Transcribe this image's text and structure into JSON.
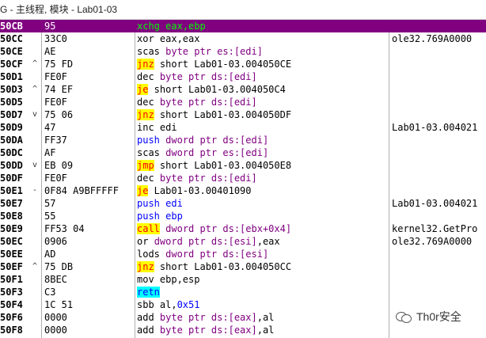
{
  "window": {
    "title": "G - 主线程, 模块 - Lab01-03"
  },
  "colors": {
    "selected_row": "#800080",
    "jcc_bg": "#ffff00",
    "jcc_fg": "#ff0000",
    "push_fg": "#0000ff",
    "mem_fg": "#800080",
    "ret_bg": "#00ffff"
  },
  "rows": [
    {
      "addr": "50CB",
      "jmp": "",
      "hex": "95",
      "tokens": [
        {
          "t": "xchg eax,",
          "s": "selx"
        },
        {
          "t": "ebp",
          "s": "selx"
        }
      ],
      "comment": "",
      "selected": true
    },
    {
      "addr": "50CC",
      "jmp": "",
      "hex": "33C0",
      "tokens": [
        {
          "t": "xor eax,eax",
          "s": "plain"
        }
      ],
      "comment": "ole32.769A0000"
    },
    {
      "addr": "50CE",
      "jmp": "",
      "hex": "AE",
      "tokens": [
        {
          "t": "scas ",
          "s": "plain"
        },
        {
          "t": "byte ptr es:[edi]",
          "s": "mem"
        }
      ],
      "comment": ""
    },
    {
      "addr": "50CF",
      "jmp": "^",
      "hex": "75 FD",
      "tokens": [
        {
          "t": "jnz",
          "s": "jcc"
        },
        {
          "t": " short Lab01-03.004050CE",
          "s": "plain"
        }
      ],
      "comment": ""
    },
    {
      "addr": "50D1",
      "jmp": "",
      "hex": "FE0F",
      "tokens": [
        {
          "t": "dec ",
          "s": "plain"
        },
        {
          "t": "byte ptr ds:[edi]",
          "s": "mem"
        }
      ],
      "comment": ""
    },
    {
      "addr": "50D3",
      "jmp": "^",
      "hex": "74 EF",
      "tokens": [
        {
          "t": "je",
          "s": "jcc"
        },
        {
          "t": " short Lab01-03.004050C4",
          "s": "plain"
        }
      ],
      "comment": ""
    },
    {
      "addr": "50D5",
      "jmp": "",
      "hex": "FE0F",
      "tokens": [
        {
          "t": "dec ",
          "s": "plain"
        },
        {
          "t": "byte ptr ds:[edi]",
          "s": "mem"
        }
      ],
      "comment": ""
    },
    {
      "addr": "50D7",
      "jmp": "v",
      "hex": "75 06",
      "tokens": [
        {
          "t": "jnz",
          "s": "jcc"
        },
        {
          "t": " short Lab01-03.004050DF",
          "s": "plain"
        }
      ],
      "comment": ""
    },
    {
      "addr": "50D9",
      "jmp": "",
      "hex": "47",
      "tokens": [
        {
          "t": "inc edi",
          "s": "plain"
        }
      ],
      "comment": "Lab01-03.004021"
    },
    {
      "addr": "50DA",
      "jmp": "",
      "hex": "FF37",
      "tokens": [
        {
          "t": "push ",
          "s": "push"
        },
        {
          "t": "dword ptr ds:[edi]",
          "s": "mem"
        }
      ],
      "comment": ""
    },
    {
      "addr": "50DC",
      "jmp": "",
      "hex": "AF",
      "tokens": [
        {
          "t": "scas ",
          "s": "plain"
        },
        {
          "t": "dword ptr es:[edi]",
          "s": "mem"
        }
      ],
      "comment": ""
    },
    {
      "addr": "50DD",
      "jmp": "v",
      "hex": "EB 09",
      "tokens": [
        {
          "t": "jmp",
          "s": "jcc"
        },
        {
          "t": " short Lab01-03.004050E8",
          "s": "plain"
        }
      ],
      "comment": ""
    },
    {
      "addr": "50DF",
      "jmp": "",
      "hex": "FE0F",
      "tokens": [
        {
          "t": "dec ",
          "s": "plain"
        },
        {
          "t": "byte ptr ds:[edi]",
          "s": "mem"
        }
      ],
      "comment": ""
    },
    {
      "addr": "50E1",
      "jmp": "-",
      "hex": "0F84 A9BFFFFF",
      "tokens": [
        {
          "t": "je",
          "s": "jcc"
        },
        {
          "t": " Lab01-03.00401090",
          "s": "plain"
        }
      ],
      "comment": ""
    },
    {
      "addr": "50E7",
      "jmp": "",
      "hex": "57",
      "tokens": [
        {
          "t": "push edi",
          "s": "push"
        }
      ],
      "comment": "Lab01-03.004021"
    },
    {
      "addr": "50E8",
      "jmp": "",
      "hex": "55",
      "tokens": [
        {
          "t": "push ebp",
          "s": "push"
        }
      ],
      "comment": ""
    },
    {
      "addr": "50E9",
      "jmp": "",
      "hex": "FF53 04",
      "tokens": [
        {
          "t": "call",
          "s": "call"
        },
        {
          "t": " ",
          "s": "plain"
        },
        {
          "t": "dword ptr ds:[ebx+0x4]",
          "s": "mem"
        }
      ],
      "comment": "kernel32.GetPro"
    },
    {
      "addr": "50EC",
      "jmp": "",
      "hex": "0906",
      "tokens": [
        {
          "t": "or ",
          "s": "plain"
        },
        {
          "t": "dword ptr ds:[esi]",
          "s": "mem"
        },
        {
          "t": ",eax",
          "s": "plain"
        }
      ],
      "comment": "ole32.769A0000"
    },
    {
      "addr": "50EE",
      "jmp": "",
      "hex": "AD",
      "tokens": [
        {
          "t": "lods ",
          "s": "plain"
        },
        {
          "t": "dword ptr ds:[esi]",
          "s": "mem"
        }
      ],
      "comment": ""
    },
    {
      "addr": "50EF",
      "jmp": "^",
      "hex": "75 DB",
      "tokens": [
        {
          "t": "jnz",
          "s": "jcc"
        },
        {
          "t": " short Lab01-03.004050CC",
          "s": "plain"
        }
      ],
      "comment": ""
    },
    {
      "addr": "50F1",
      "jmp": "",
      "hex": "8BEC",
      "tokens": [
        {
          "t": "mov ebp,esp",
          "s": "plain"
        }
      ],
      "comment": ""
    },
    {
      "addr": "50F3",
      "jmp": "",
      "hex": "C3",
      "tokens": [
        {
          "t": "retn",
          "s": "ret"
        }
      ],
      "comment": ""
    },
    {
      "addr": "50F4",
      "jmp": "",
      "hex": "1C 51",
      "tokens": [
        {
          "t": "sbb al,",
          "s": "plain"
        },
        {
          "t": "0x51",
          "s": "imm"
        }
      ],
      "comment": ""
    },
    {
      "addr": "50F6",
      "jmp": "",
      "hex": "0000",
      "tokens": [
        {
          "t": "add ",
          "s": "plain"
        },
        {
          "t": "byte ptr ds:[eax]",
          "s": "mem"
        },
        {
          "t": ",al",
          "s": "plain"
        }
      ],
      "comment": ""
    },
    {
      "addr": "50F8",
      "jmp": "",
      "hex": "0000",
      "tokens": [
        {
          "t": "add ",
          "s": "plain"
        },
        {
          "t": "byte ptr ds:[eax]",
          "s": "mem"
        },
        {
          "t": ",al",
          "s": "plain"
        }
      ],
      "comment": ""
    }
  ],
  "watermark": {
    "text": "Th0r安全",
    "icon": "wechat-icon"
  }
}
